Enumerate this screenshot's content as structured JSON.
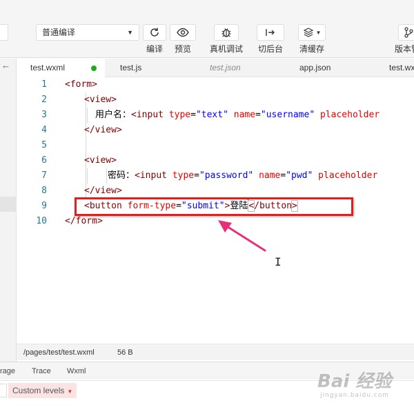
{
  "toolbar": {
    "compile_mode": "普通编译",
    "buttons": [
      {
        "label": "编译",
        "icon": "refresh-icon"
      },
      {
        "label": "预览",
        "icon": "eye-icon"
      },
      {
        "label": "真机调试",
        "icon": "bug-icon"
      },
      {
        "label": "切后台",
        "icon": "switch-background-icon"
      },
      {
        "label": "清缓存",
        "icon": "layers-icon"
      },
      {
        "label": "版本管",
        "icon": "branch-icon"
      }
    ]
  },
  "tabs": [
    {
      "label": "test.wxml",
      "active": true,
      "modified": true
    },
    {
      "label": "test.js",
      "active": false
    },
    {
      "label": "test.json",
      "active": false,
      "preview": true
    },
    {
      "label": "app.json",
      "active": false
    },
    {
      "label": "test.wx",
      "active": false
    }
  ],
  "editor": {
    "line_numbers": [
      "1",
      "2",
      "3",
      "4",
      "5",
      "6",
      "7",
      "8",
      "9",
      "10"
    ],
    "lines": [
      [
        {
          "k": "br",
          "t": "<"
        },
        {
          "k": "tag",
          "t": "form"
        },
        {
          "k": "br",
          "t": ">"
        }
      ],
      [
        {
          "k": "br",
          "t": "<"
        },
        {
          "k": "tag",
          "t": "view"
        },
        {
          "k": "br",
          "t": ">"
        }
      ],
      [
        {
          "k": "txt",
          "t": "用户名："
        },
        {
          "k": "br",
          "t": "<"
        },
        {
          "k": "tag",
          "t": "input"
        },
        {
          "k": "sp",
          "t": " "
        },
        {
          "k": "attr",
          "t": "type"
        },
        {
          "k": "eq",
          "t": "="
        },
        {
          "k": "val",
          "t": "\"text\""
        },
        {
          "k": "sp",
          "t": " "
        },
        {
          "k": "attr",
          "t": "name"
        },
        {
          "k": "eq",
          "t": "="
        },
        {
          "k": "val",
          "t": "\"username\""
        },
        {
          "k": "sp",
          "t": " "
        },
        {
          "k": "attr",
          "t": "placeholder"
        }
      ],
      [
        {
          "k": "br",
          "t": "</"
        },
        {
          "k": "tag",
          "t": "view"
        },
        {
          "k": "br",
          "t": ">"
        }
      ],
      [],
      [
        {
          "k": "br",
          "t": "<"
        },
        {
          "k": "tag",
          "t": "view"
        },
        {
          "k": "br",
          "t": ">"
        }
      ],
      [
        {
          "k": "txt",
          "t": "密码："
        },
        {
          "k": "br",
          "t": "<"
        },
        {
          "k": "tag",
          "t": "input"
        },
        {
          "k": "sp",
          "t": " "
        },
        {
          "k": "attr",
          "t": "type"
        },
        {
          "k": "eq",
          "t": "="
        },
        {
          "k": "val",
          "t": "\"password\""
        },
        {
          "k": "sp",
          "t": " "
        },
        {
          "k": "attr",
          "t": "name"
        },
        {
          "k": "eq",
          "t": "="
        },
        {
          "k": "val",
          "t": "\"pwd\""
        },
        {
          "k": "sp",
          "t": " "
        },
        {
          "k": "attr",
          "t": "placeholder"
        }
      ],
      [
        {
          "k": "br",
          "t": "</"
        },
        {
          "k": "tag",
          "t": "view"
        },
        {
          "k": "br",
          "t": ">"
        }
      ],
      [
        {
          "k": "br",
          "t": "<"
        },
        {
          "k": "tag",
          "t": "button"
        },
        {
          "k": "sp",
          "t": " "
        },
        {
          "k": "attr",
          "t": "form-type"
        },
        {
          "k": "eq",
          "t": "="
        },
        {
          "k": "val",
          "t": "\"submit\""
        },
        {
          "k": "br",
          "t": ">"
        },
        {
          "k": "txt",
          "t": "登陆"
        },
        {
          "k": "cursor",
          "t": ""
        },
        {
          "k": "brm",
          "t": "<"
        },
        {
          "k": "br",
          "t": "/"
        },
        {
          "k": "tag",
          "t": "button"
        },
        {
          "k": "brm",
          "t": ">"
        }
      ],
      [
        {
          "k": "br",
          "t": "</"
        },
        {
          "k": "tag",
          "t": "form"
        },
        {
          "k": "br",
          "t": ">"
        }
      ]
    ]
  },
  "statusbar": {
    "path": "/pages/test/test.wxml",
    "size": "56 B"
  },
  "debug_panel": {
    "tabs": [
      "rage",
      "Trace",
      "Wxml"
    ],
    "levels_label": "Custom levels"
  },
  "watermark": {
    "logo_text": "Bai 经验",
    "url_text": "jingyan.baidu.com"
  },
  "colors": {
    "highlight_box": "#e0201f",
    "annotation_arrow": "#e8307a",
    "modified_dot": "#1aad19"
  }
}
